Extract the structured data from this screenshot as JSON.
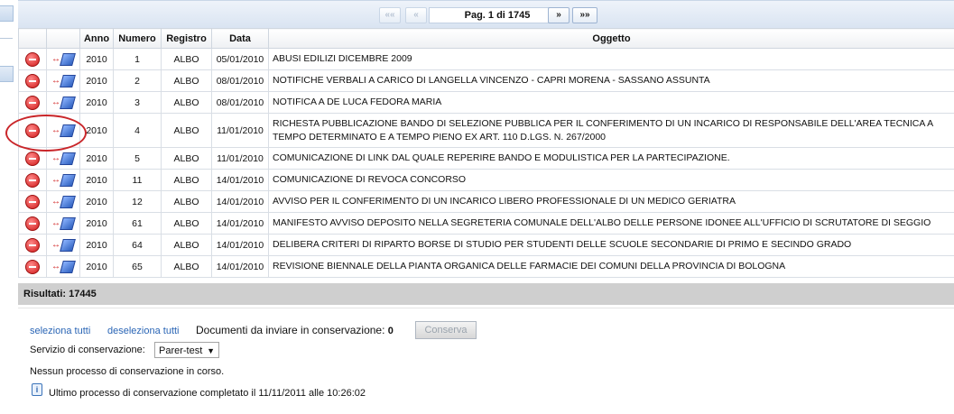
{
  "pager": {
    "first": "««",
    "prev": "«",
    "info": "Pag. 1 di 1745",
    "next": "»",
    "last": "»»"
  },
  "table": {
    "headers": [
      "Anno",
      "Numero",
      "Registro",
      "Data",
      "Oggetto"
    ],
    "rows": [
      {
        "anno": "2010",
        "numero": "1",
        "registro": "ALBO",
        "data": "05/01/2010",
        "oggetto": "ABUSI EDILIZI DICEMBRE 2009"
      },
      {
        "anno": "2010",
        "numero": "2",
        "registro": "ALBO",
        "data": "08/01/2010",
        "oggetto": "NOTIFICHE VERBALI A CARICO DI LANGELLA VINCENZO - CAPRI MORENA - SASSANO ASSUNTA"
      },
      {
        "anno": "2010",
        "numero": "3",
        "registro": "ALBO",
        "data": "08/01/2010",
        "oggetto": "NOTIFICA A DE LUCA FEDORA MARIA"
      },
      {
        "anno": "2010",
        "numero": "4",
        "registro": "ALBO",
        "data": "11/01/2010",
        "oggetto": "RICHESTA PUBBLICAZIONE BANDO DI SELEZIONE PUBBLICA PER IL CONFERIMENTO DI UN INCARICO DI RESPONSABILE DELL'AREA TECNICA A TEMPO DETERMINATO E A TEMPO PIENO EX ART. 110 D.LGS. N. 267/2000"
      },
      {
        "anno": "2010",
        "numero": "5",
        "registro": "ALBO",
        "data": "11/01/2010",
        "oggetto": "COMUNICAZIONE DI LINK DAL QUALE REPERIRE BANDO E MODULISTICA PER LA PARTECIPAZIONE."
      },
      {
        "anno": "2010",
        "numero": "11",
        "registro": "ALBO",
        "data": "14/01/2010",
        "oggetto": "COMUNICAZIONE DI REVOCA CONCORSO"
      },
      {
        "anno": "2010",
        "numero": "12",
        "registro": "ALBO",
        "data": "14/01/2010",
        "oggetto": "AVVISO PER IL CONFERIMENTO DI UN INCARICO LIBERO PROFESSIONALE DI UN MEDICO GERIATRA"
      },
      {
        "anno": "2010",
        "numero": "61",
        "registro": "ALBO",
        "data": "14/01/2010",
        "oggetto": "MANIFESTO AVVISO DEPOSITO NELLA SEGRETERIA COMUNALE DELL'ALBO DELLE PERSONE IDONEE ALL'UFFICIO DI SCRUTATORE DI SEGGIO"
      },
      {
        "anno": "2010",
        "numero": "64",
        "registro": "ALBO",
        "data": "14/01/2010",
        "oggetto": "DELIBERA CRITERI DI RIPARTO BORSE DI STUDIO PER STUDENTI DELLE SCUOLE SECONDARIE DI PRIMO E SECINDO GRADO"
      },
      {
        "anno": "2010",
        "numero": "65",
        "registro": "ALBO",
        "data": "14/01/2010",
        "oggetto": "REVISIONE BIENNALE DELLA PIANTA ORGANICA DELLE FARMACIE DEI COMUNI DELLA PROVINCIA DI BOLOGNA"
      }
    ]
  },
  "results": {
    "label": "Risultati: 17445"
  },
  "bottom": {
    "select_all": "seleziona tutti",
    "deselect_all": "deseleziona tutti",
    "docs_label": "Documenti da inviare in conservazione:",
    "docs_count": "0",
    "conserva_button": "Conserva",
    "service_label": "Servizio di conservazione:",
    "service_value": "Parer-test",
    "no_process": "Nessun processo di conservazione in corso.",
    "last_process": "Ultimo processo di conservazione completato il 11/11/2011 alle 10:26:02"
  },
  "icons": {
    "remove": "minus-circle-icon",
    "send": "send-arrow-book-icon",
    "info": "info-icon"
  },
  "colors": {
    "accent_link": "#2a65b5",
    "highlight_circle": "#c9262a",
    "remove_icon": "#d01818"
  }
}
